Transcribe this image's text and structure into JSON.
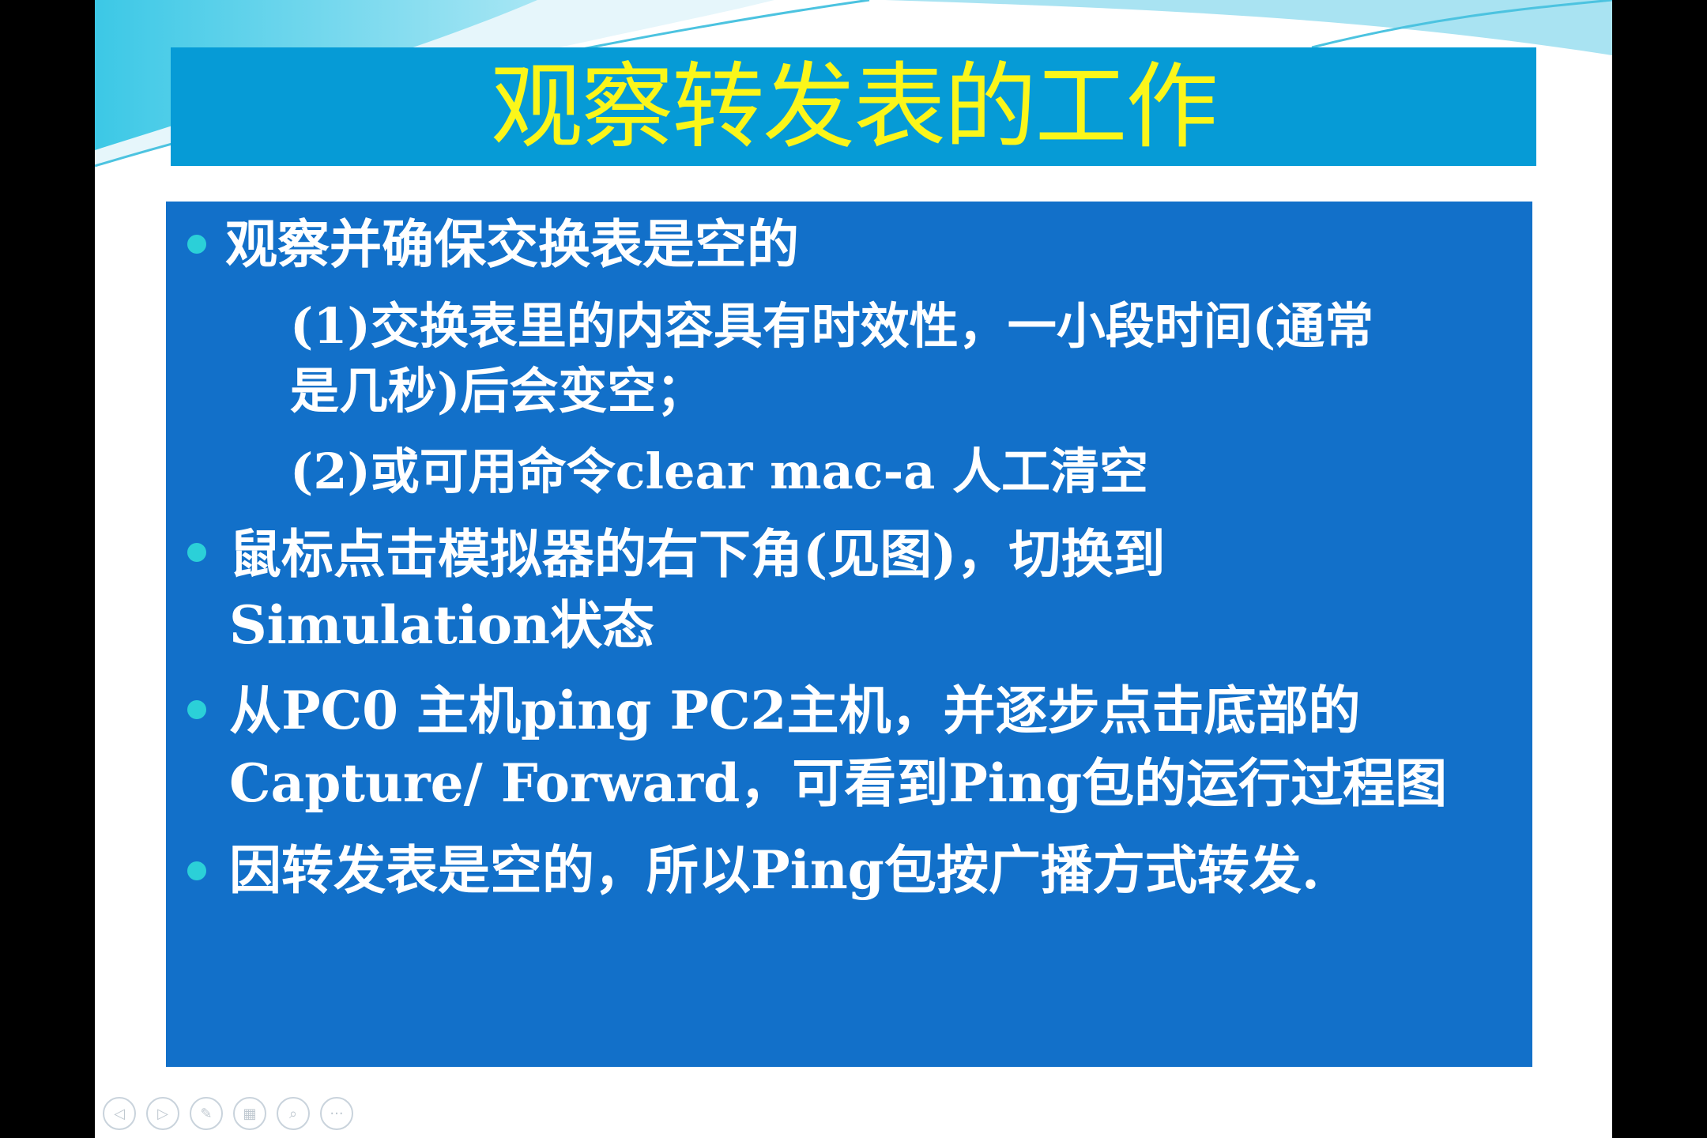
{
  "slide": {
    "title": "观察转发表的工作",
    "bullets": [
      {
        "text": "观察并确保交换表是空的",
        "sub": [
          "(1)交换表里的内容具有时效性，一小段时间(通常",
          "是几秒)后会变空；",
          "(2)或可用命令clear mac-a 人工清空"
        ]
      },
      {
        "line1": "鼠标点击模拟器的右下角(见图)，切换到",
        "line2": "Simulation状态"
      },
      {
        "line1": "从PC0 主机ping PC2主机，并逐步点击底部的",
        "line2": "Capture/ Forward，可看到Ping包的运行过程图"
      },
      {
        "line1": "因转发表是空的，所以Ping包按广播方式转发."
      }
    ]
  },
  "toolbar": {
    "buttons": [
      "prev-icon",
      "next-icon",
      "pen-icon",
      "slides-icon",
      "zoom-icon",
      "more-icon"
    ]
  },
  "colors": {
    "title_bar": "#069bd6",
    "title_text": "#fbf61a",
    "content_box": "#1270c9",
    "bullet": "#2bd0d8",
    "text": "#ffffff"
  }
}
